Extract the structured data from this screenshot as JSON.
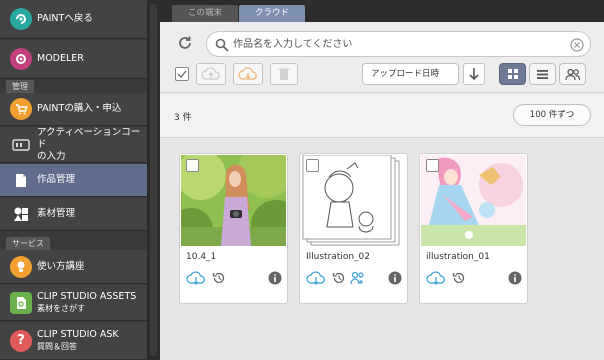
{
  "sidebar": {
    "items": [
      {
        "label": "PAINTへ戻る",
        "sublabel": ""
      },
      {
        "label": "MODELER",
        "sublabel": ""
      },
      {
        "label": "PAINTの購入・申込",
        "sublabel": ""
      },
      {
        "label": "アクティベーションコード",
        "sublabel": "の入力"
      },
      {
        "label": "作品管理",
        "sublabel": ""
      },
      {
        "label": "素材管理",
        "sublabel": ""
      },
      {
        "label": "使い方講座",
        "sublabel": ""
      },
      {
        "label": "CLIP STUDIO ASSETS",
        "sublabel": "素材をさがす"
      },
      {
        "label": "CLIP STUDIO ASK",
        "sublabel": "質問＆回答"
      }
    ],
    "sections": {
      "management": "管理",
      "service": "サービス"
    }
  },
  "tabs": [
    "この端末",
    "クラウド"
  ],
  "search": {
    "placeholder": "作品名を入力してください"
  },
  "sort": {
    "selected": "アップロード日時"
  },
  "count": "3 件",
  "per_page": "100 件ずつ",
  "works": [
    {
      "title": "10.4_1"
    },
    {
      "title": "Illustration_02"
    },
    {
      "title": "illustration_01"
    }
  ],
  "colors": {
    "accent": "#5f6c8c",
    "cloud_blue": "#3aa0d8",
    "paint_teal": "#2aa8a0",
    "modeler_pink": "#c2407e",
    "orange": "#f0a030"
  }
}
